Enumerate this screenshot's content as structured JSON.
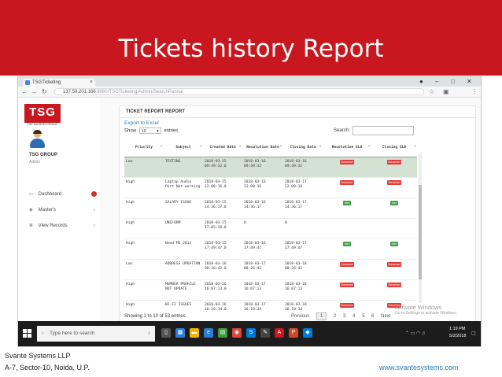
{
  "slide": {
    "title": "Tickets history Report",
    "company_line1": "Svante Systems LLP",
    "company_line2": "A-7, Sector-10, Noida, U.P.",
    "website": "www.svantesystems.com",
    "accent_color": "#c8171f"
  },
  "browser": {
    "tab_title": "TSGTicketing",
    "url_host": "137.59.201.166",
    "url_path": ":8080/TSGTicketing/Admin/SearchPannal"
  },
  "sidebar": {
    "logo_text": "TSG",
    "logo_sub": "THE SACHDEV GROUP",
    "user_name": "TSG GROUP",
    "user_role": "Admin",
    "items": [
      {
        "label": "Dashboard",
        "icon": "monitor-icon"
      },
      {
        "label": "Master's",
        "icon": "layers-icon"
      },
      {
        "label": "View Records",
        "icon": "list-icon"
      }
    ]
  },
  "report": {
    "card_title": "TICKET REPORT REPORT",
    "export_label": "Export to Excel",
    "show_label": "Show",
    "entries_value": "10",
    "entries_label": "entries",
    "search_label": "Search:",
    "columns": [
      "Priority",
      "Subject",
      "Created Date",
      "Resolution Date",
      "Closing Date",
      "Resolution SLA",
      "Closing SLA"
    ],
    "rows": [
      {
        "priority": "Low",
        "subject": "TESTING",
        "created": "2018-03-15 09:49:32.0",
        "resolution": "2018-03-16 09:49:32",
        "closing": "2018-03-16 09:49:32",
        "res_sla": "Breached",
        "close_sla": "Breached",
        "selected": true
      },
      {
        "priority": "High",
        "subject": "Laptop Audio Port Not working",
        "created": "2018-03-15 12:00:16.0",
        "resolution": "2018-03-16 12:00:16",
        "closing": "2018-03-17 12:00:16",
        "res_sla": "Breached",
        "close_sla": "Breached",
        "selected": false
      },
      {
        "priority": "High",
        "subject": "SALARY ISSUE",
        "created": "2018-03-15 14:36:17.0",
        "resolution": "2018-03-16 14:36:17",
        "closing": "2018-03-17 14:36:17",
        "res_sla": "Met",
        "close_sla": "Met",
        "selected": false
      },
      {
        "priority": "High",
        "subject": "UNIFORM",
        "created": "2018-03-15 17:05:16.0",
        "resolution": "0",
        "closing": "0",
        "res_sla": "",
        "close_sla": "",
        "selected": false
      },
      {
        "priority": "High",
        "subject": "Need MS 2013",
        "created": "2018-03-15 17:49:47.0",
        "resolution": "2018-03-16 17:49:47",
        "closing": "2018-03-17 17:49:47",
        "res_sla": "Met",
        "close_sla": "Met",
        "selected": false
      },
      {
        "priority": "Low",
        "subject": "ADDRESS UPDATION",
        "created": "2018-03-16 08:26:42.0",
        "resolution": "2018-03-17 08:26:42",
        "closing": "2018-03-18 08:26:42",
        "res_sla": "Breached",
        "close_sla": "Breached",
        "selected": false
      },
      {
        "priority": "High",
        "subject": "MEMBER PROFILE NOT UPDATE",
        "created": "2018-03-16 16:07:13.0",
        "resolution": "2018-03-17 16:07:13",
        "closing": "2018-03-18 16:07:13",
        "res_sla": "Breached",
        "close_sla": "Breached",
        "selected": false
      },
      {
        "priority": "High",
        "subject": "WI-FI ISSUES",
        "created": "2018-03-16 16:10:34.0",
        "resolution": "2018-03-17 16:10:34",
        "closing": "2018-03-18 16:10:34",
        "res_sla": "Breached",
        "close_sla": "Breached",
        "selected": false
      }
    ],
    "page_info": "Showing 1 to 10 of 53 entries",
    "pager": {
      "previous": "Previous",
      "pages": [
        "1",
        "2",
        "3",
        "4",
        "5",
        "6"
      ],
      "current": "1",
      "next": "Next"
    },
    "watermark_line1": "Activate Windows",
    "watermark_line2": "Go to Settings to activate Windows."
  },
  "taskbar": {
    "search_placeholder": "Type here to search",
    "time": "1:19 PM",
    "date": "5/2/2018"
  }
}
